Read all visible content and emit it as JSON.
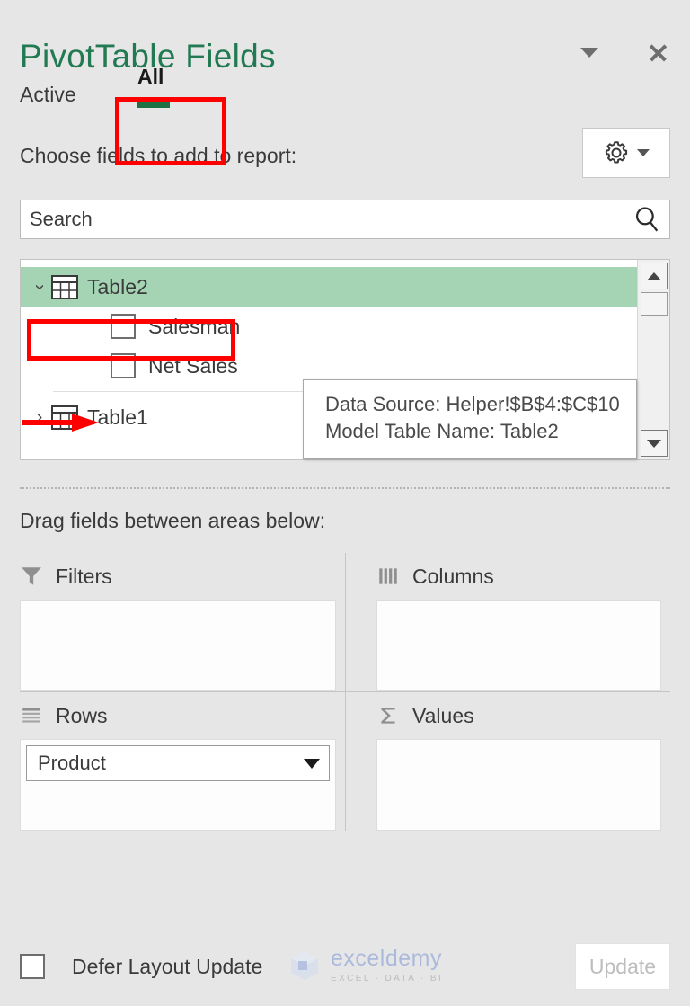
{
  "header": {
    "title": "PivotTable Fields",
    "dropdown_icon": "chevron-down-icon",
    "close_icon": "close-icon"
  },
  "tabs": {
    "items": [
      {
        "label": "Active",
        "selected": false
      },
      {
        "label": "All",
        "selected": true
      }
    ],
    "active_underline_color": "#1e7145",
    "annotation_color": "#ff0000"
  },
  "field_chooser": {
    "label": "Choose fields to add to report:",
    "tools_button": {
      "icon": "gear-icon",
      "caret": "chevron-down-icon"
    }
  },
  "search": {
    "placeholder": "Search",
    "value": "",
    "icon": "search-icon"
  },
  "field_list": {
    "nodes": [
      {
        "type": "table",
        "label": "Table2",
        "expanded": true,
        "selected": true,
        "icon": "table-icon"
      },
      {
        "type": "field",
        "label": "Salesman",
        "checked": false
      },
      {
        "type": "field",
        "label": "Net Sales",
        "checked": false
      },
      {
        "type": "divider"
      },
      {
        "type": "table",
        "label": "Table1",
        "expanded": false,
        "selected": false,
        "icon": "table-icon"
      }
    ],
    "scrollbar": {
      "up_icon": "scroll-up-icon",
      "down_icon": "scroll-down-icon"
    }
  },
  "tooltip": {
    "lines": [
      "Data Source: Helper!$B$4:$C$10",
      "Model Table Name: Table2"
    ]
  },
  "drag_section": {
    "label": "Drag fields between areas below:",
    "areas": [
      {
        "name": "Filters",
        "icon": "filter-funnel-icon",
        "fields": []
      },
      {
        "name": "Columns",
        "icon": "columns-icon",
        "fields": []
      },
      {
        "name": "Rows",
        "icon": "rows-icon",
        "fields": [
          "Product"
        ]
      },
      {
        "name": "Values",
        "icon": "sigma-icon",
        "fields": []
      }
    ]
  },
  "footer": {
    "defer_label": "Defer Layout Update",
    "defer_checked": false,
    "update_label": "Update",
    "update_enabled": false
  },
  "watermark": {
    "name": "exceldemy",
    "tagline": "EXCEL · DATA · BI"
  }
}
